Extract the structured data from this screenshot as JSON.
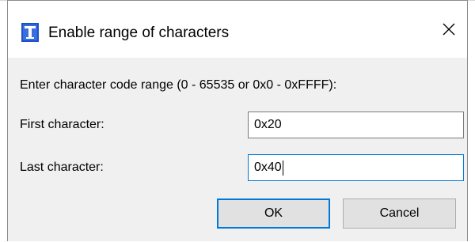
{
  "dialog": {
    "title": "Enable range of characters",
    "close_icon": "close-icon",
    "app_icon": "app-icon"
  },
  "content": {
    "instruction": "Enter character code range (0 - 65535 or 0x0 - 0xFFFF):",
    "first_label": "First character:",
    "first_value": "0x20",
    "last_label": "Last character:",
    "last_value": "0x40"
  },
  "buttons": {
    "ok_label": "OK",
    "cancel_label": "Cancel"
  },
  "colors": {
    "accent": "#0078d7",
    "dialog_bg": "#f0f0f0",
    "icon_blue": "#1e50c8"
  }
}
